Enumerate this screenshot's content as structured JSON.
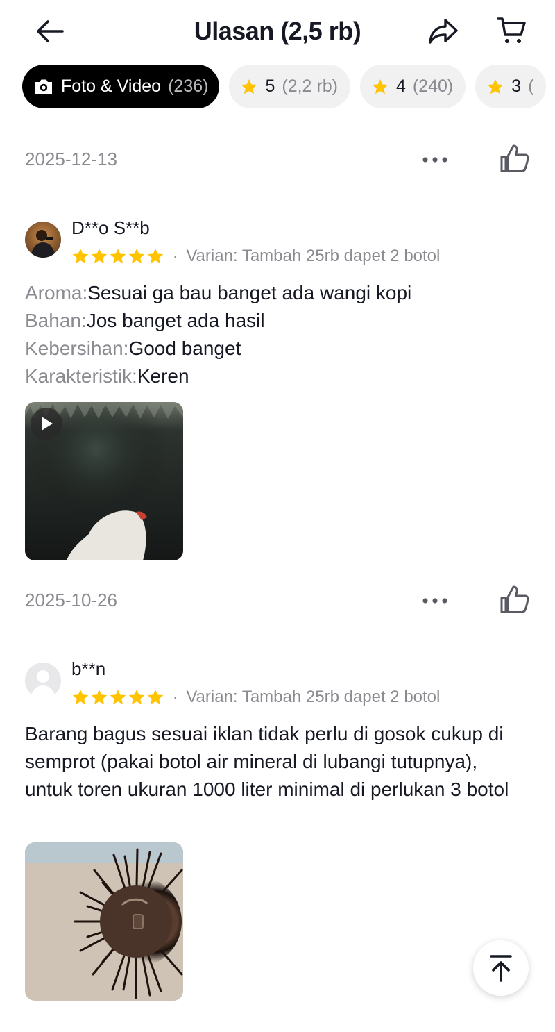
{
  "header": {
    "title": "Ulasan (2,5 rb)",
    "back_icon": "arrow-left-icon",
    "share_icon": "share-arrow-icon",
    "cart_icon": "cart-icon"
  },
  "filters": [
    {
      "label": "Foto & Video",
      "count": "(236)",
      "icon": "camera-icon",
      "active": true
    },
    {
      "label": "5",
      "count": "(2,2 rb)",
      "icon": "star-icon",
      "active": false
    },
    {
      "label": "4",
      "count": "(240)",
      "icon": "star-icon",
      "active": false
    },
    {
      "label": "3",
      "count": "(",
      "icon": "star-icon",
      "active": false
    }
  ],
  "top_meta": {
    "date": "2025-12-13"
  },
  "reviews": [
    {
      "user": "D**o S**b",
      "rating": 5,
      "dot": "·",
      "variant": "Varian: Tambah 25rb dapet 2 botol",
      "lines": [
        {
          "label": "Aroma:",
          "value": "Sesuai ga bau banget ada wangi kopi"
        },
        {
          "label": "Bahan:",
          "value": "Jos banget ada hasil"
        },
        {
          "label": "Kebersihan:",
          "value": "Good banget"
        },
        {
          "label": "Karakteristik:",
          "value": "Keren"
        }
      ],
      "media_type": "video",
      "date": "2025-10-26"
    },
    {
      "user": "b**n",
      "rating": 5,
      "dot": "·",
      "variant": "Varian: Tambah 25rb dapet 2 botol",
      "text": "Barang bagus sesuai iklan tidak perlu di gosok cukup di semprot (pakai botol air mineral di lubangi tutupnya), untuk toren ukuran 1000 liter minimal di perlukan 3 botol",
      "media_type": "photo"
    }
  ],
  "colors": {
    "star": "#FFC300",
    "muted": "#8a8b91",
    "text": "#161823",
    "chip_bg": "#f1f1f2"
  },
  "scroll_top_icon": "arrow-up-to-top-icon"
}
